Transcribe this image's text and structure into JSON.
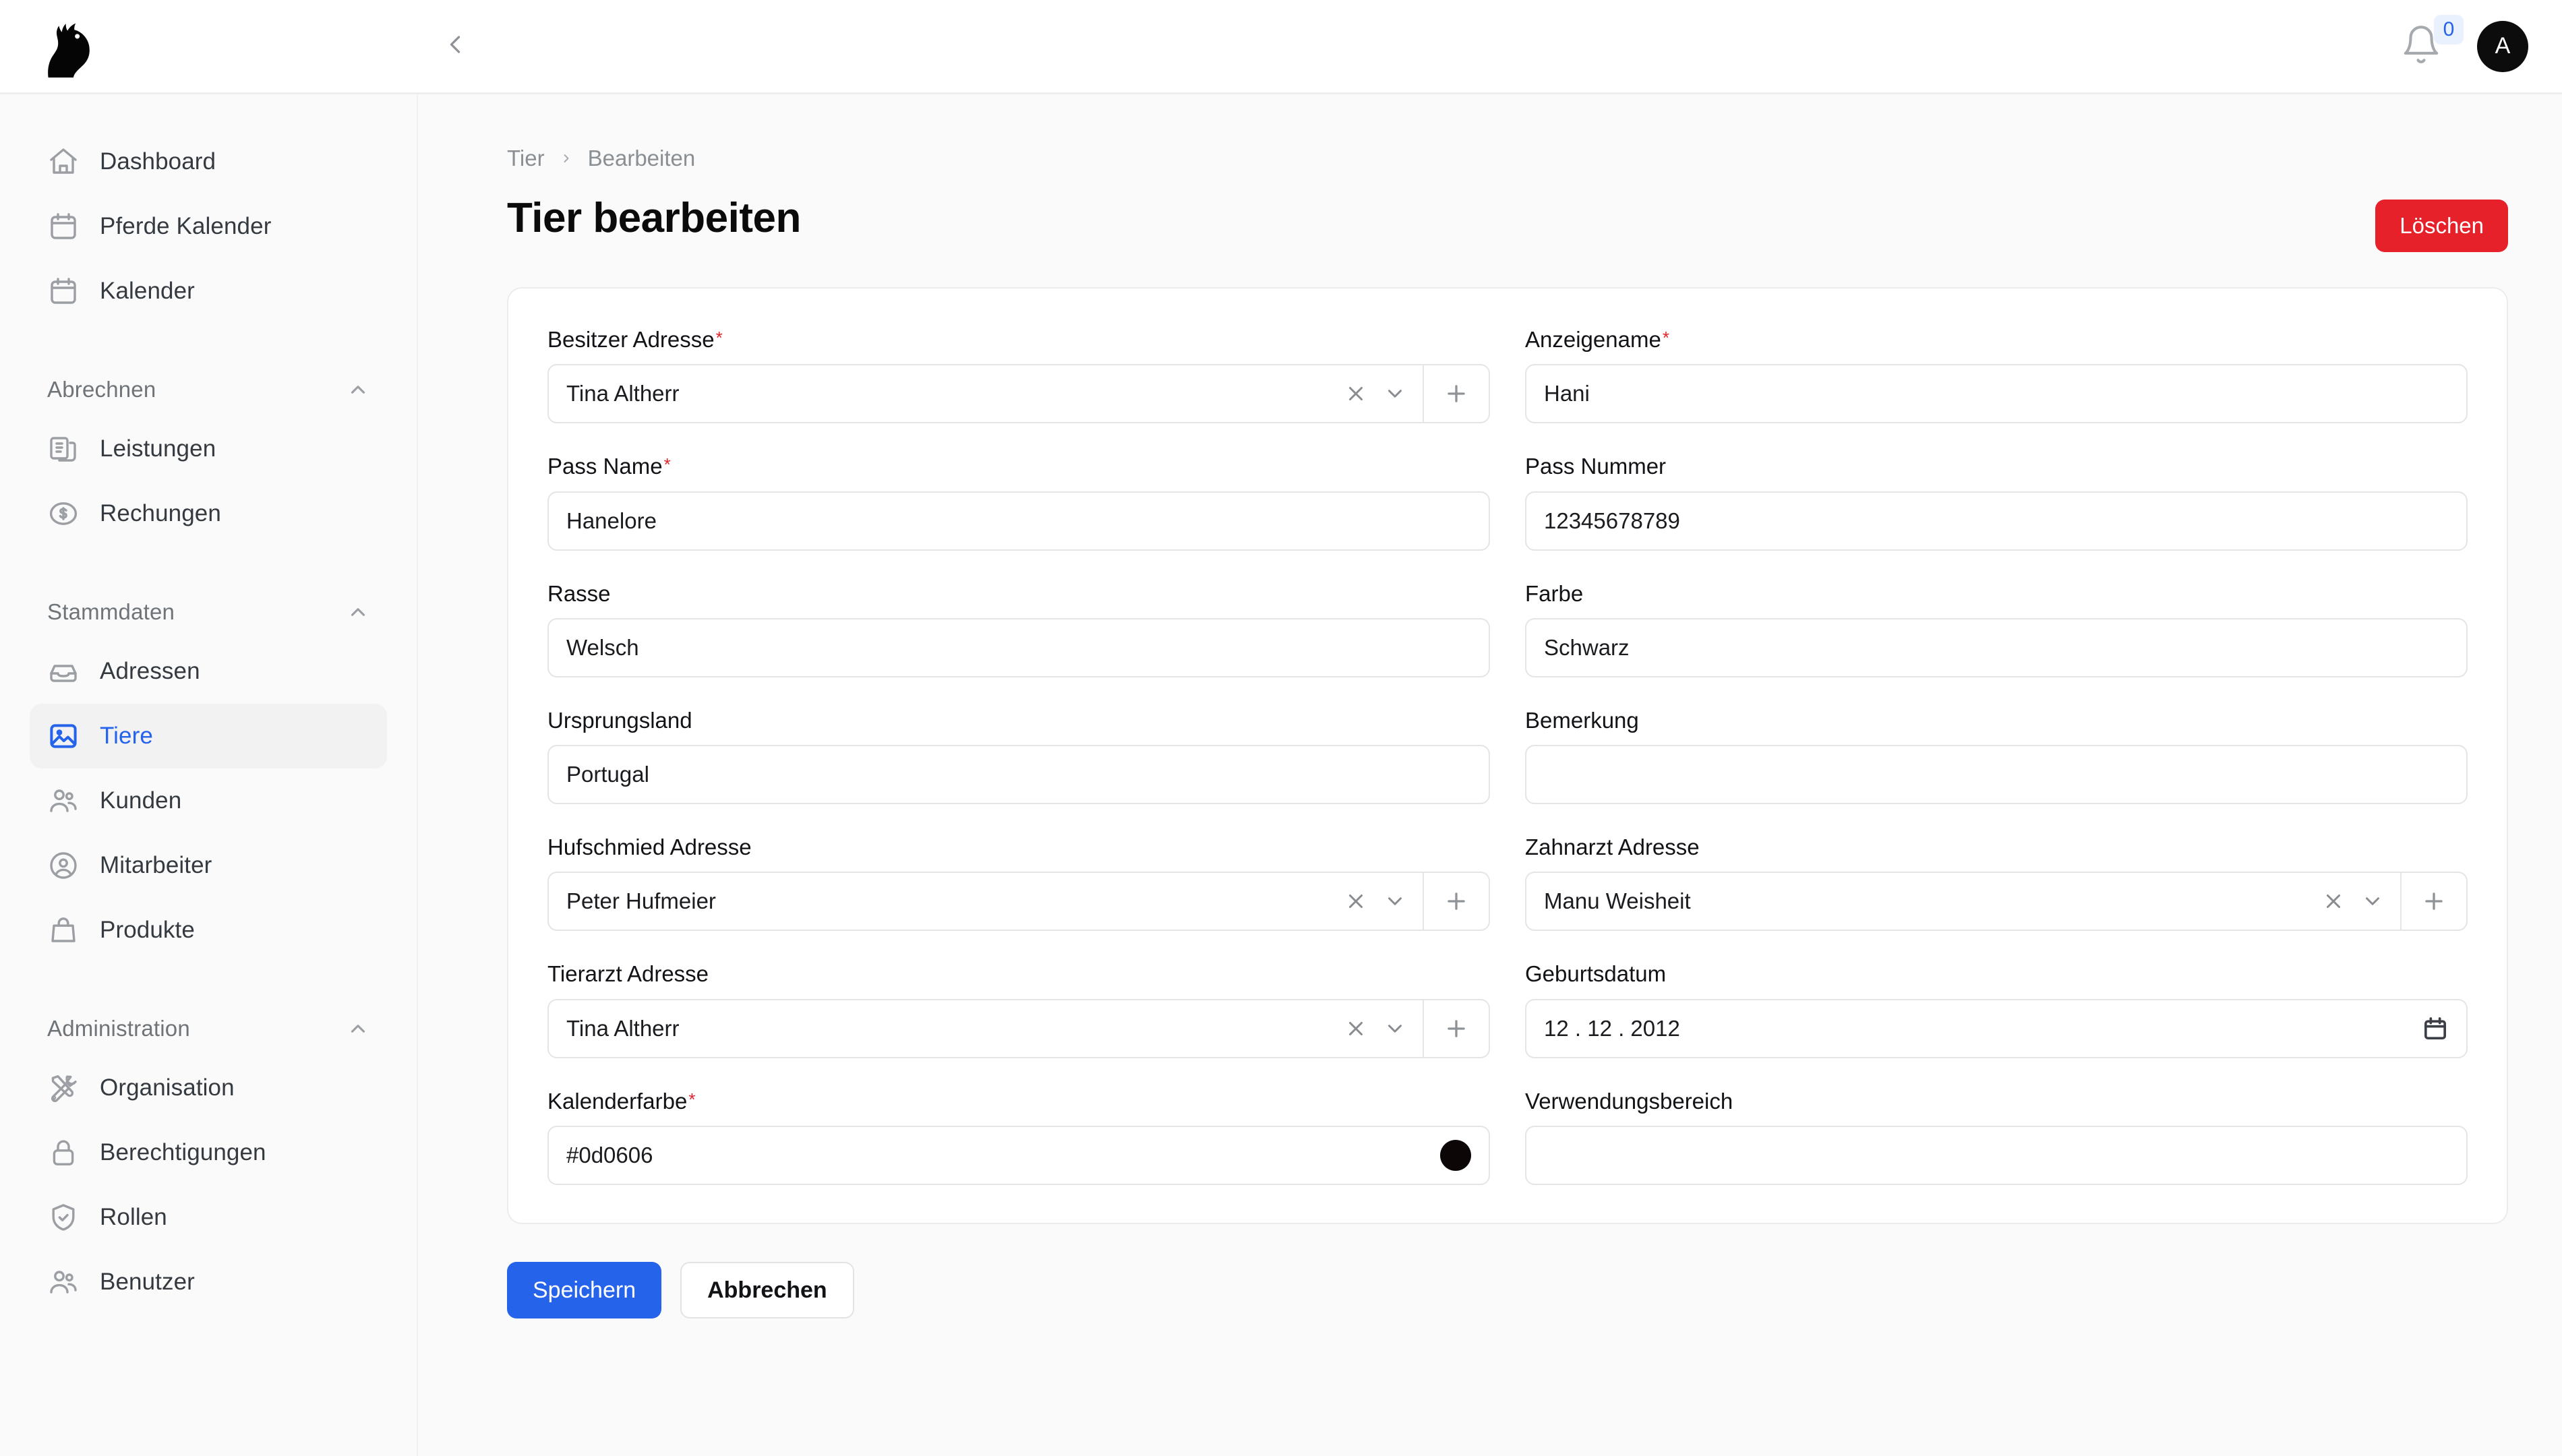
{
  "topbar": {
    "logo_icon": "horse-head-logo",
    "collapse_icon": "chevron-left-icon",
    "notification_icon": "bell-icon",
    "notification_count": "0",
    "avatar_initial": "A"
  },
  "sidebar": {
    "top_items": [
      {
        "label": "Dashboard",
        "icon": "home-icon"
      },
      {
        "label": "Pferde Kalender",
        "icon": "calendar-icon"
      },
      {
        "label": "Kalender",
        "icon": "calendar-icon"
      }
    ],
    "groups": [
      {
        "title": "Abrechnen",
        "collapse_icon": "chevron-up-icon",
        "items": [
          {
            "label": "Leistungen",
            "icon": "documents-icon"
          },
          {
            "label": "Rechungen",
            "icon": "dollar-circle-icon"
          }
        ]
      },
      {
        "title": "Stammdaten",
        "collapse_icon": "chevron-up-icon",
        "items": [
          {
            "label": "Adressen",
            "icon": "inbox-tray-icon"
          },
          {
            "label": "Tiere",
            "icon": "image-icon",
            "active": true
          },
          {
            "label": "Kunden",
            "icon": "users-icon"
          },
          {
            "label": "Mitarbeiter",
            "icon": "user-circle-icon"
          },
          {
            "label": "Produkte",
            "icon": "bag-icon"
          }
        ]
      },
      {
        "title": "Administration",
        "collapse_icon": "chevron-up-icon",
        "items": [
          {
            "label": "Organisation",
            "icon": "tools-icon"
          },
          {
            "label": "Berechtigungen",
            "icon": "lock-icon"
          },
          {
            "label": "Rollen",
            "icon": "shield-check-icon"
          },
          {
            "label": "Benutzer",
            "icon": "users-icon"
          }
        ]
      }
    ]
  },
  "breadcrumb": {
    "items": [
      "Tier",
      "Bearbeiten"
    ],
    "separator_icon": "chevron-right-icon"
  },
  "header": {
    "title": "Tier bearbeiten",
    "delete_label": "Löschen",
    "delete_color": "#e62129"
  },
  "form": {
    "fields": [
      {
        "label": "Besitzer Adresse",
        "required": true,
        "type": "combobox",
        "value": "Tina Altherr",
        "clear_icon": "close-icon",
        "chevron_icon": "chevron-down-icon",
        "add_icon": "plus-icon"
      },
      {
        "label": "Anzeigename",
        "required": true,
        "type": "text",
        "value": "Hani",
        "placeholder": ""
      },
      {
        "label": "Pass Name",
        "required": true,
        "type": "text",
        "value": "Hanelore",
        "placeholder": ""
      },
      {
        "label": "Pass Nummer",
        "required": false,
        "type": "text",
        "value": "12345678789",
        "placeholder": ""
      },
      {
        "label": "Rasse",
        "required": false,
        "type": "text",
        "value": "Welsch",
        "placeholder": ""
      },
      {
        "label": "Farbe",
        "required": false,
        "type": "text",
        "value": "Schwarz",
        "placeholder": ""
      },
      {
        "label": "Ursprungsland",
        "required": false,
        "type": "text",
        "value": "Portugal",
        "placeholder": ""
      },
      {
        "label": "Bemerkung",
        "required": false,
        "type": "text",
        "value": "",
        "placeholder": ""
      },
      {
        "label": "Hufschmied Adresse",
        "required": false,
        "type": "combobox",
        "value": "Peter Hufmeier",
        "clear_icon": "close-icon",
        "chevron_icon": "chevron-down-icon",
        "add_icon": "plus-icon"
      },
      {
        "label": "Zahnarzt Adresse",
        "required": false,
        "type": "combobox",
        "value": "Manu Weisheit",
        "clear_icon": "close-icon",
        "chevron_icon": "chevron-down-icon",
        "add_icon": "plus-icon"
      },
      {
        "label": "Tierarzt Adresse",
        "required": false,
        "type": "combobox",
        "value": "Tina Altherr",
        "clear_icon": "close-icon",
        "chevron_icon": "chevron-down-icon",
        "add_icon": "plus-icon"
      },
      {
        "label": "Geburtsdatum",
        "required": false,
        "type": "date",
        "value": "12 . 12 . 2012",
        "picker_icon": "calendar-picker-icon"
      },
      {
        "label": "Kalenderfarbe",
        "required": true,
        "type": "color",
        "value": "#0d0606",
        "swatch_color": "#0d0606"
      },
      {
        "label": "Verwendungsbereich",
        "required": false,
        "type": "text",
        "value": "",
        "placeholder": ""
      }
    ],
    "save_label": "Speichern",
    "cancel_label": "Abbrechen",
    "save_color": "#2563eb"
  }
}
